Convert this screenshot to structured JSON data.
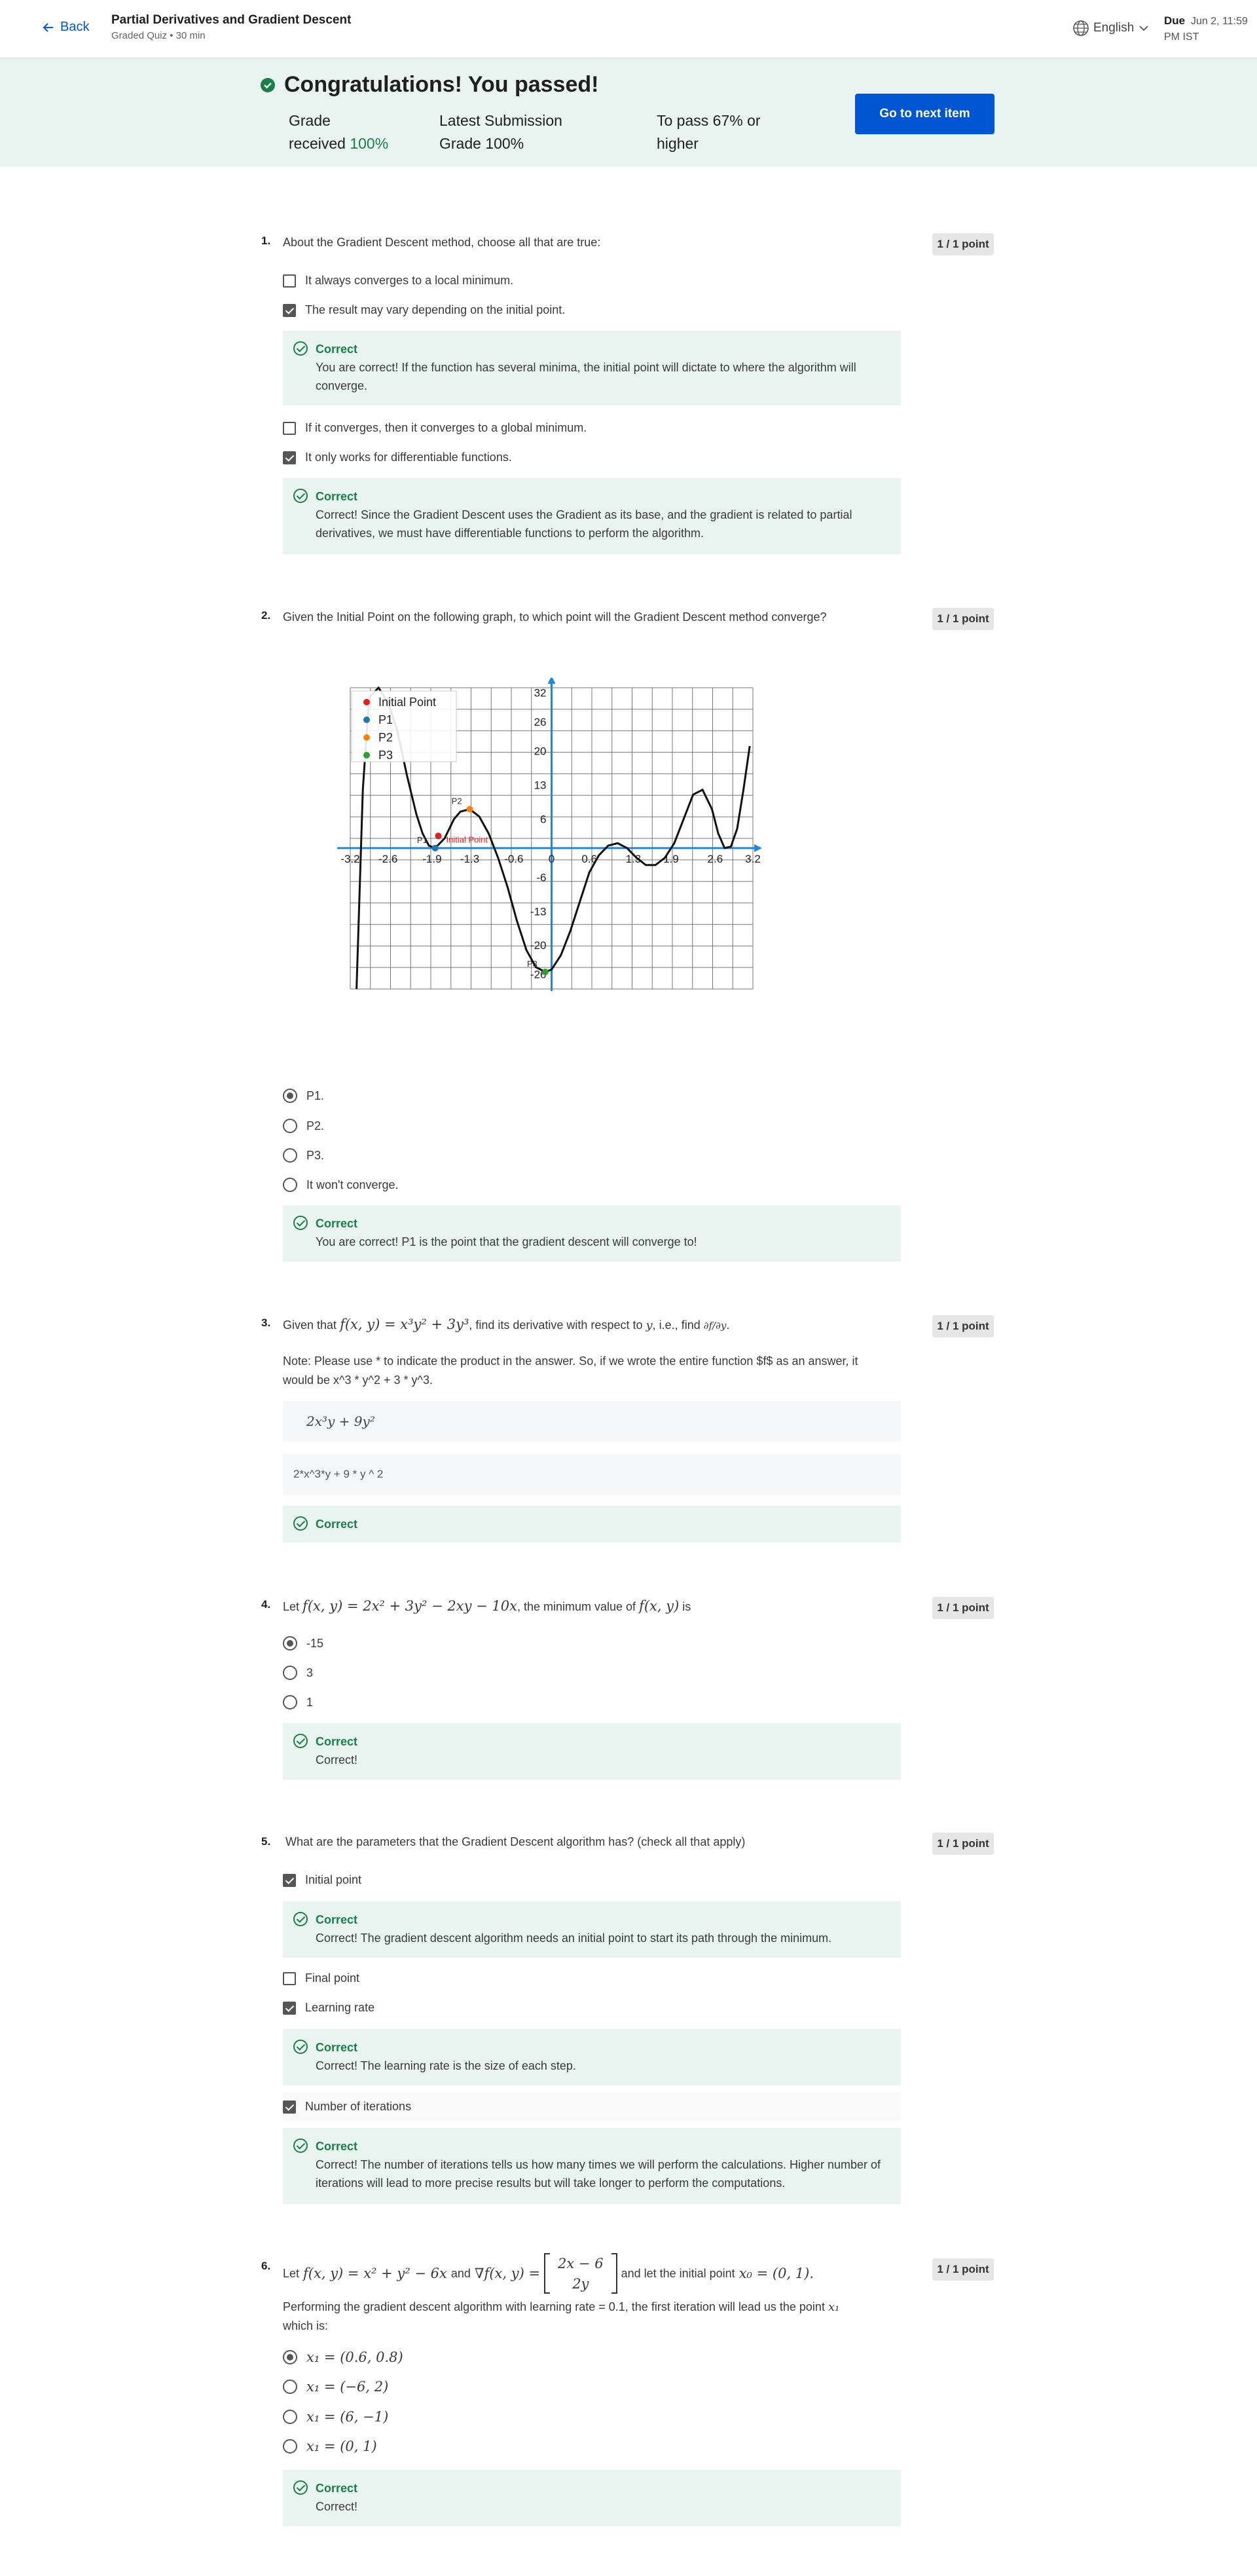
{
  "header": {
    "back_label": "Back",
    "title": "Partial Derivatives and Gradient Descent",
    "subtitle": "Graded Quiz • 30 min",
    "language": "English",
    "due_label": "Due",
    "due_date": "Jun 2, 11:59",
    "due_time": "PM IST"
  },
  "banner": {
    "title": "Congratulations! You passed!",
    "grade_label_1": "Grade",
    "grade_label_2": "received",
    "grade_value": "100%",
    "latest_label_1": "Latest Submission",
    "latest_label_2": "Grade",
    "latest_value": "100%",
    "pass_label_1": "To pass",
    "pass_value": "67%",
    "pass_label_1b": "or",
    "pass_label_2": "higher",
    "next_button": "Go to next item"
  },
  "points_label": "1 / 1 point",
  "correct_label": "Correct",
  "q1": {
    "num": "1.",
    "text": "About the Gradient Descent method, choose all that are true:",
    "options": [
      "It always converges to a local minimum.",
      "The result may vary depending on the initial point.",
      "If it converges, then it converges to a global minimum.",
      "It only works for differentiable functions."
    ],
    "fb1": "You are correct! If the function has several minima, the initial point will dictate to where the algorithm will converge.",
    "fb2": "Correct! Since the Gradient Descent uses the Gradient as its base, and the gradient is related to partial derivatives, we must have differentiable functions to perform the algorithm."
  },
  "q2": {
    "num": "2.",
    "text": "Given the Initial Point on the following graph, to which point will the Gradient Descent method converge?",
    "options": [
      "P1.",
      "P2.",
      "P3.",
      "It won't converge."
    ],
    "fb": "You are correct! P1 is the point that the gradient descent will converge to!"
  },
  "chart_data": {
    "type": "line",
    "x_ticks": [
      "-3.2",
      "-2.6",
      "-1.9",
      "-1.3",
      "-0.6",
      "0",
      "0.6",
      "1.3",
      "1.9",
      "2.6",
      "3.2"
    ],
    "y_ticks": [
      "32",
      "26",
      "20",
      "13",
      "6",
      "0",
      "-6",
      "-13",
      "-20",
      "-26"
    ],
    "xlim": [
      -3.2,
      3.2
    ],
    "ylim": [
      -29,
      33
    ],
    "legend": [
      "Initial Point",
      "P1",
      "P2",
      "P3"
    ],
    "legend_colors": [
      "#e02020",
      "#1f77b4",
      "#ff7f0e",
      "#2ca02c"
    ],
    "legend_position": "top-left",
    "grid": true,
    "curve_x": [
      -3.1,
      -3.0,
      -2.9,
      -2.75,
      -2.6,
      -2.45,
      -2.3,
      -2.15,
      -2.05,
      -1.95,
      -1.85,
      -1.7,
      -1.55,
      -1.45,
      -1.3,
      -1.15,
      -1.0,
      -0.85,
      -0.7,
      -0.55,
      -0.4,
      -0.25,
      -0.1,
      0.0,
      0.15,
      0.3,
      0.45,
      0.6,
      0.75,
      0.9,
      1.05,
      1.2,
      1.35,
      1.5,
      1.65,
      1.8,
      1.95,
      2.1,
      2.25,
      2.4,
      2.55,
      2.65,
      2.75,
      2.85,
      2.95,
      3.05,
      3.15
    ],
    "curve_y": [
      -29,
      12,
      31,
      33,
      30,
      24,
      15,
      7,
      3,
      0.5,
      0,
      2,
      6,
      7.5,
      8,
      6.5,
      3,
      -2,
      -8,
      -15,
      -21,
      -24.5,
      -25.5,
      -25,
      -22,
      -17,
      -11,
      -5,
      -1.5,
      0.5,
      1,
      0,
      -2,
      -3.5,
      -3.5,
      -2,
      1,
      6,
      11,
      12,
      8,
      3,
      0,
      0.3,
      4,
      12,
      21
    ],
    "points": [
      {
        "name": "Initial Point",
        "x": -1.8,
        "y": 2.5
      },
      {
        "name": "P1",
        "x": -1.85,
        "y": 0
      },
      {
        "name": "P2",
        "x": -1.3,
        "y": 8
      },
      {
        "name": "P3",
        "x": -0.1,
        "y": -25.5
      }
    ]
  },
  "q3": {
    "num": "3.",
    "text_pre": "Given that",
    "expr": "f(x, y) = x³y² + 3y³",
    "text_mid": ", find its derivative with respect to",
    "var": "y",
    "text_mid2": ", i.e., find",
    "deriv": "∂f/∂y",
    "text_end": ".",
    "note_1": "Note: Please use * to indicate the product in the answer. So, if we wrote the entire function $f$ as an answer, it",
    "note_2": "would be x^3 * y^2 + 3 * y^3.",
    "preview": "2x³y + 9y²",
    "answer": "2*x^3*y + 9 * y ^ 2"
  },
  "q4": {
    "num": "4.",
    "text_pre": "Let",
    "expr": "f(x, y) = 2x² + 3y² − 2xy − 10x",
    "text_post": ", the minimum value of",
    "expr2": "f(x, y)",
    "text_end": "is",
    "options": [
      "-15",
      "3",
      "1"
    ],
    "fb": "Correct!"
  },
  "q5": {
    "num": "5.",
    "text": "What are the parameters that the Gradient Descent algorithm has? (check all that apply)",
    "options": [
      "Initial point",
      "Final point",
      "Learning rate",
      "Number of iterations"
    ],
    "fb1": "Correct! The gradient descent algorithm needs an initial point to start its path through the minimum.",
    "fb2": "Correct! The learning rate is the size of each step.",
    "fb3": "Correct! The number of iterations tells us how many times we will perform the calculations. Higher number of iterations will lead to more precise results but will take longer to perform the computations."
  },
  "q6": {
    "num": "6.",
    "text_pre": "Let",
    "expr": "f(x, y) = x² + y² − 6x",
    "text_and": "and",
    "grad": "∇f(x, y) =",
    "m1": "2x − 6",
    "m2": "2y",
    "text_post": "and let the initial point",
    "x0": "x₀ = (0, 1).",
    "line2_pre": "Performing the gradient descent algorithm with learning rate = 0.1, the first iteration will lead us the point",
    "x1": "x₁",
    "line3": "which is:",
    "options": [
      "x₁ = (0.6, 0.8)",
      "x₁ = (−6, 2)",
      "x₁ = (6, −1)",
      "x₁ = (0, 1)"
    ],
    "fb": "Correct!"
  }
}
